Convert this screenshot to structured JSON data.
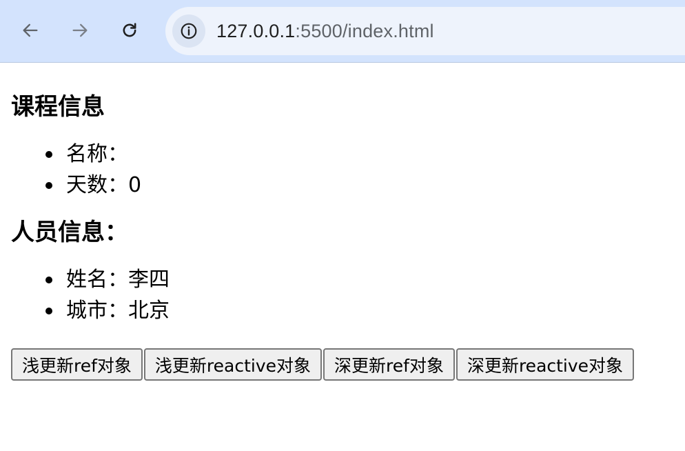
{
  "browser": {
    "url_host": "127.0.0.1",
    "url_path": ":5500/index.html"
  },
  "course": {
    "heading": "课程信息",
    "items": [
      {
        "label": "名称：",
        "value": ""
      },
      {
        "label": "天数：",
        "value": "0"
      }
    ]
  },
  "person": {
    "heading": "人员信息：",
    "items": [
      {
        "label": "姓名：",
        "value": "李四"
      },
      {
        "label": "城市：",
        "value": "北京"
      }
    ]
  },
  "buttons": [
    "浅更新ref对象",
    "浅更新reactive对象",
    "深更新ref对象",
    "深更新reactive对象"
  ],
  "icons": {
    "back": "arrow-left-icon",
    "forward": "arrow-right-icon",
    "reload": "reload-icon",
    "site_info": "info-icon"
  }
}
